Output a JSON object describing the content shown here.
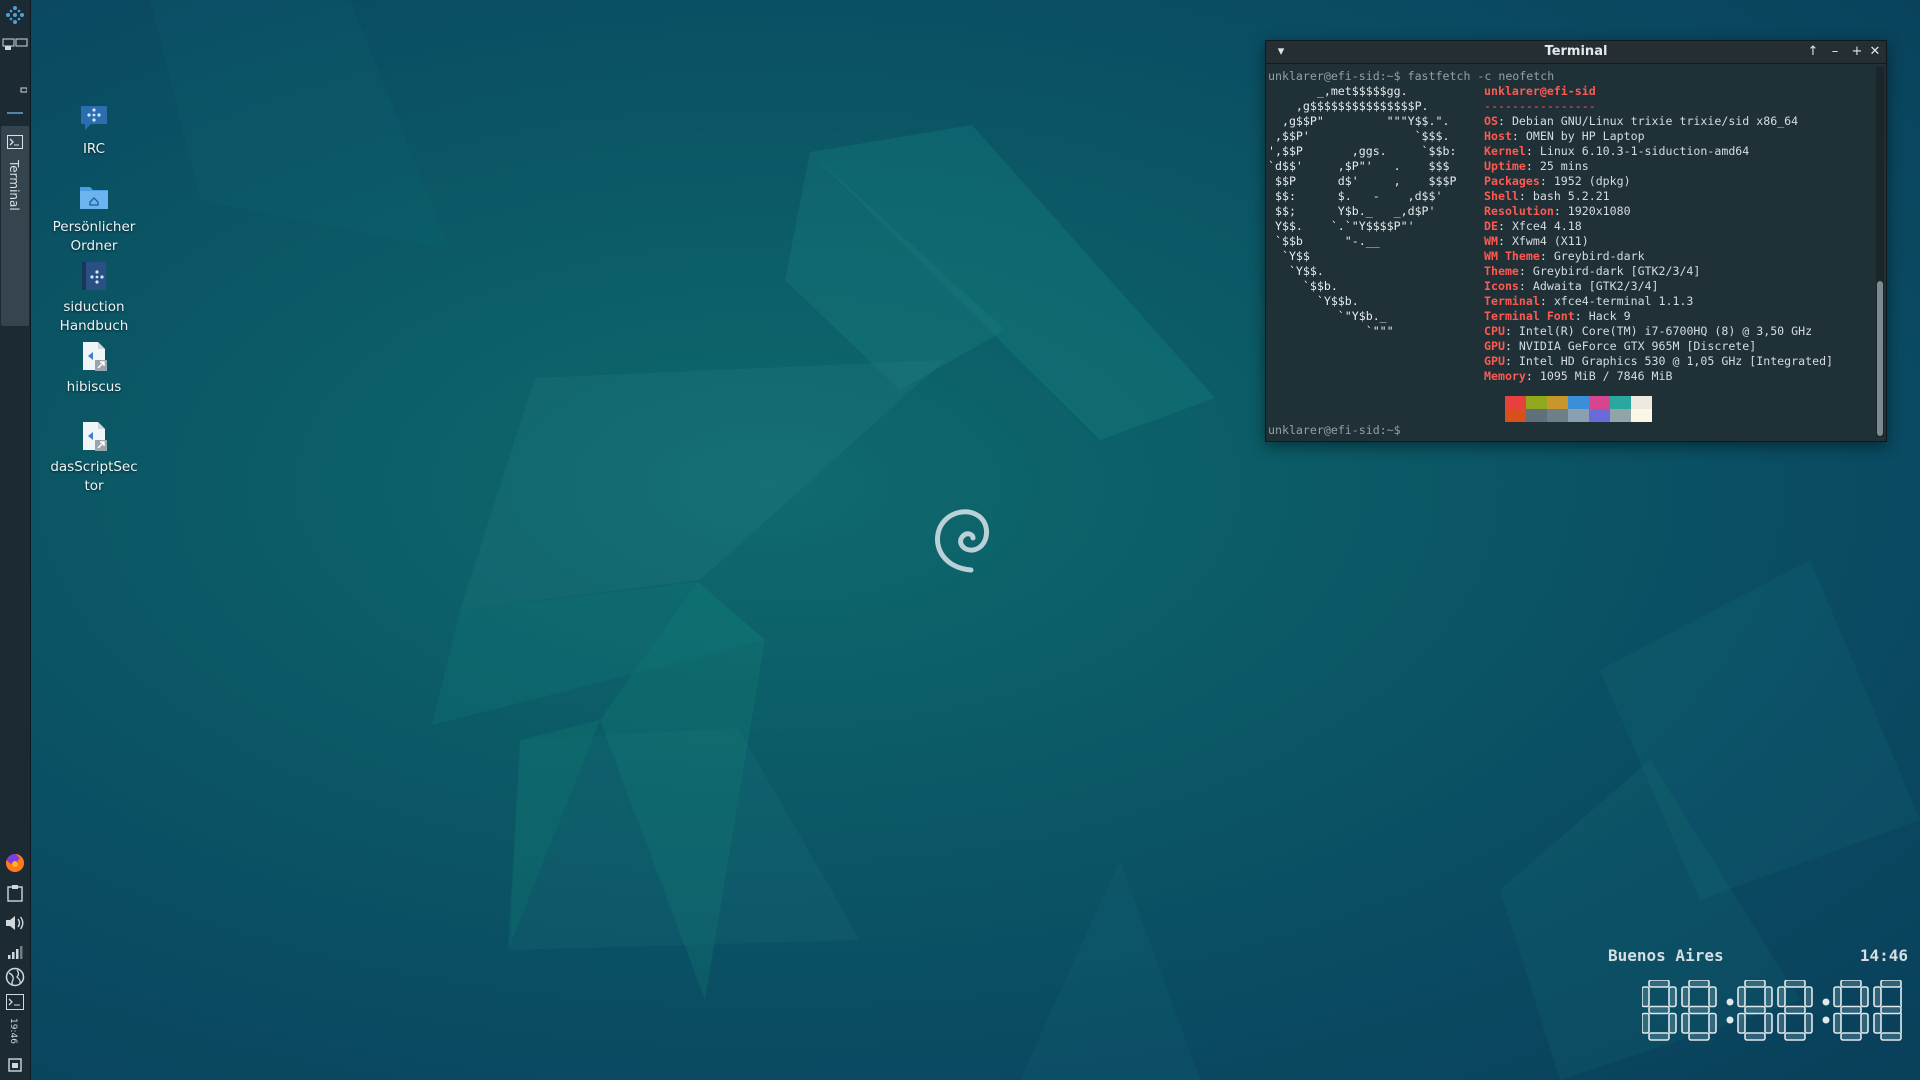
{
  "desktop": {
    "icons": [
      {
        "label": "IRC"
      },
      {
        "label": "Persönlicher\nOrdner"
      },
      {
        "label": "siduction\nHandbuch"
      },
      {
        "label": "hibiscus"
      },
      {
        "label": "dasScriptSec\ntor"
      }
    ]
  },
  "panel": {
    "taskbar_terminal_label": "Terminal",
    "clock_vertical": "19:46",
    "icons": [
      "app-menu-icon",
      "workspace-switcher-icon",
      "terminal-icon",
      "firefox-icon",
      "clipboard-icon",
      "volume-icon",
      "network-signal-icon",
      "language-globe-icon",
      "terminal-launcher-icon",
      "power-icon"
    ]
  },
  "terminal": {
    "title": "Terminal",
    "command_line": "unklarer@efi-sid:~$ fastfetch -c neofetch",
    "final_prompt": "unklarer@efi-sid:~$",
    "user_host": "unklarer@efi-sid",
    "separator": "----------------",
    "ascii_art": "       _,met$$$$$gg.\n    ,g$$$$$$$$$$$$$$$P.\n  ,g$$P\"         \"\"\"Y$$.\".\n ,$$P'               `$$$.\n',$$P       ,ggs.     `$$b:\n`d$$'     ,$P\"'   .    $$$\n $$P      d$'     ,    $$$P\n $$:      $.   -    ,d$$'\n $$;      Y$b._   _,d$P'\n Y$$.    `.`\"Y$$$$P\"'\n `$$b      \"-.__\n  `Y$$\n   `Y$$.\n     `$$b.\n       `Y$$b.\n          `\"Y$b._\n              `\"\"\"",
    "info": [
      {
        "key": "OS",
        "value": "Debian GNU/Linux trixie trixie/sid x86_64"
      },
      {
        "key": "Host",
        "value": "OMEN by HP Laptop"
      },
      {
        "key": "Kernel",
        "value": "Linux 6.10.3-1-siduction-amd64"
      },
      {
        "key": "Uptime",
        "value": "25 mins"
      },
      {
        "key": "Packages",
        "value": "1952 (dpkg)"
      },
      {
        "key": "Shell",
        "value": "bash 5.2.21"
      },
      {
        "key": "Resolution",
        "value": "1920x1080"
      },
      {
        "key": "DE",
        "value": "Xfce4 4.18"
      },
      {
        "key": "WM",
        "value": "Xfwm4 (X11)"
      },
      {
        "key": "WM Theme",
        "value": "Greybird-dark"
      },
      {
        "key": "Theme",
        "value": "Greybird-dark [GTK2/3/4]"
      },
      {
        "key": "Icons",
        "value": "Adwaita [GTK2/3/4]"
      },
      {
        "key": "Terminal",
        "value": "xfce4-terminal 1.1.3"
      },
      {
        "key": "Terminal Font",
        "value": "Hack 9"
      },
      {
        "key": "CPU",
        "value": "Intel(R) Core(TM) i7-6700HQ (8) @ 3,50 GHz"
      },
      {
        "key": "GPU",
        "value": "NVIDIA GeForce GTX 965M [Discrete]"
      },
      {
        "key": "GPU",
        "value": "Intel HD Graphics 530 @ 1,05 GHz [Integrated]"
      },
      {
        "key": "Memory",
        "value": "1095 MiB / 7846 MiB"
      }
    ],
    "palette_top": [
      "#1f3036",
      "#e8403c",
      "#8fa81c",
      "#c8962a",
      "#3a8fd8",
      "#d8458f",
      "#2aa8a0",
      "#eeeae0"
    ],
    "palette_bottom": [
      "#1f3036",
      "#d8501c",
      "#60707a",
      "#6f7f88",
      "#88a0b0",
      "#6a6ad8",
      "#93a4a8",
      "#fbf6e6"
    ],
    "buttons": [
      "menu",
      "raise",
      "minimize",
      "maximize",
      "close"
    ]
  },
  "clock": {
    "city": "Buenos Aires",
    "time": "14:46",
    "big_display": "88:88:88"
  },
  "colors": {
    "accent_red": "#ff5a52",
    "panel_bg": "#1c2b33",
    "wallpaper_teal": "#0f6a6e"
  }
}
